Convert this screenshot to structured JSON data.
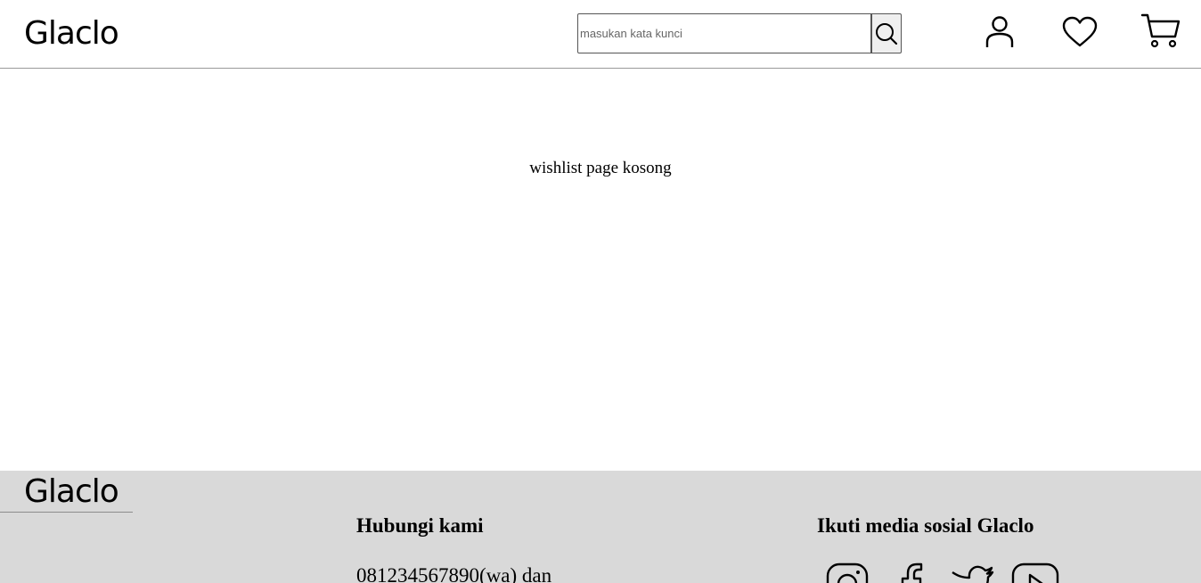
{
  "header": {
    "logo": "Glaclo",
    "search": {
      "placeholder": "masukan kata kunci",
      "value": ""
    },
    "icons": {
      "search": "search-icon",
      "account": "user-icon",
      "wishlist": "heart-icon",
      "cart": "cart-icon"
    }
  },
  "main": {
    "empty_message": "wishlist page kosong"
  },
  "footer": {
    "logo": "Glaclo",
    "contact": {
      "heading": "Hubungi kami",
      "text": "081234567890(wa) dan"
    },
    "social": {
      "heading": "Ikuti media sosial Glaclo",
      "icons": [
        "instagram-icon",
        "facebook-icon",
        "twitter-icon",
        "youtube-icon"
      ]
    }
  },
  "colors": {
    "footer_bg": "#d9d9d9",
    "header_border": "#9a9a9a"
  }
}
